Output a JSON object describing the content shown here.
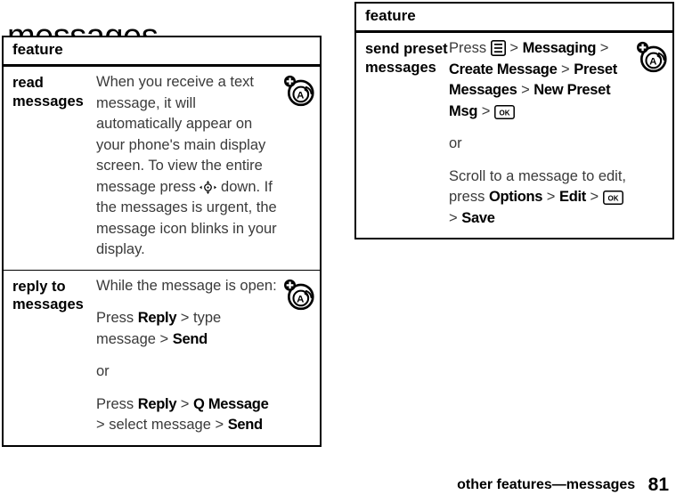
{
  "page": {
    "title": "messages",
    "footer_label": "other features—messages",
    "footer_page": "81"
  },
  "tables": [
    {
      "header": "feature",
      "rows": [
        {
          "label": "read messages",
          "icon": "text-message-icon",
          "blocks": [
            {
              "parts": [
                {
                  "type": "text",
                  "value": "When you receive a text message, it will automatically appear on your phone's main display screen. To view the entire message press "
                },
                {
                  "type": "icon",
                  "value": "nav-key-icon"
                },
                {
                  "type": "text",
                  "value": " down. If the messages is urgent, the message icon blinks in your display."
                }
              ]
            }
          ]
        },
        {
          "label": "reply to messages",
          "icon": "text-message-icon",
          "blocks": [
            {
              "parts": [
                {
                  "type": "text",
                  "value": "While the message is open:"
                }
              ]
            },
            {
              "parts": [
                {
                  "type": "text",
                  "value": "Press "
                },
                {
                  "type": "bold",
                  "value": "Reply"
                },
                {
                  "type": "gt",
                  "value": " > "
                },
                {
                  "type": "text",
                  "value": "type message"
                },
                {
                  "type": "gt",
                  "value": " > "
                },
                {
                  "type": "bold",
                  "value": "Send"
                }
              ]
            },
            {
              "parts": [
                {
                  "type": "text",
                  "value": "or"
                }
              ]
            },
            {
              "parts": [
                {
                  "type": "text",
                  "value": "Press "
                },
                {
                  "type": "bold",
                  "value": "Reply"
                },
                {
                  "type": "gt",
                  "value": " > "
                },
                {
                  "type": "bold",
                  "value": "Q Message"
                },
                {
                  "type": "gt",
                  "value": " > "
                },
                {
                  "type": "text",
                  "value": "select message"
                },
                {
                  "type": "gt",
                  "value": " > "
                },
                {
                  "type": "bold",
                  "value": "Send"
                }
              ]
            }
          ]
        }
      ]
    },
    {
      "header": "feature",
      "rows": [
        {
          "label": "send preset messages",
          "icon": "text-message-icon",
          "blocks": [
            {
              "parts": [
                {
                  "type": "text",
                  "value": "Press "
                },
                {
                  "type": "icon",
                  "value": "menu-key-icon"
                },
                {
                  "type": "gt",
                  "value": " > "
                },
                {
                  "type": "bold",
                  "value": "Messaging"
                },
                {
                  "type": "gt",
                  "value": " > "
                },
                {
                  "type": "bold",
                  "value": "Create Message"
                },
                {
                  "type": "gt",
                  "value": " > "
                },
                {
                  "type": "bold",
                  "value": "Preset Messages"
                },
                {
                  "type": "gt",
                  "value": " > "
                },
                {
                  "type": "bold",
                  "value": "New Preset Msg"
                },
                {
                  "type": "gt",
                  "value": " > "
                },
                {
                  "type": "icon",
                  "value": "ok-key-icon"
                }
              ]
            },
            {
              "parts": [
                {
                  "type": "text",
                  "value": "or"
                }
              ]
            },
            {
              "parts": [
                {
                  "type": "text",
                  "value": "Scroll to a message to edit, press "
                },
                {
                  "type": "bold",
                  "value": "Options"
                },
                {
                  "type": "gt",
                  "value": " > "
                },
                {
                  "type": "bold",
                  "value": "Edit"
                },
                {
                  "type": "gt",
                  "value": " > "
                },
                {
                  "type": "icon",
                  "value": "ok-key-icon"
                },
                {
                  "type": "gt",
                  "value": " > "
                },
                {
                  "type": "bold",
                  "value": "Save"
                }
              ]
            }
          ]
        }
      ]
    }
  ],
  "colors": {
    "ink": "#000000",
    "body_text": "#3a3a3a",
    "background": "#ffffff"
  }
}
